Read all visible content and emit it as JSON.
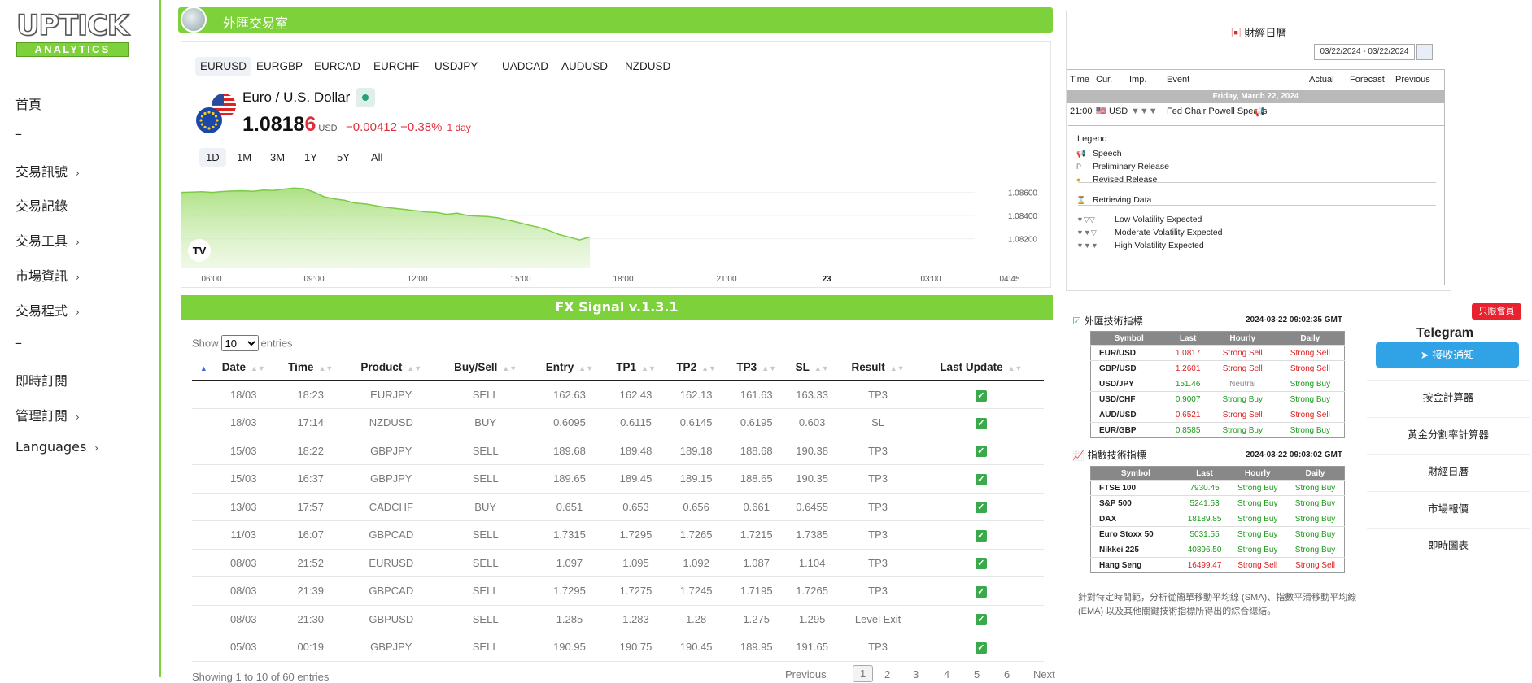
{
  "sidebar": {
    "logo_top": "UPTICK",
    "logo_bottom": "ANALYTICS",
    "items": [
      "首頁",
      "–",
      "交易訊號",
      "交易記錄",
      "交易工具",
      "市場資訊",
      "交易程式",
      "–",
      "即時訂閱",
      "管理訂閱",
      "Languages"
    ],
    "chevrons": [
      false,
      false,
      true,
      false,
      true,
      true,
      true,
      false,
      false,
      true,
      true
    ]
  },
  "header": {
    "title": "外匯交易室"
  },
  "widget": {
    "symbols": [
      "EURUSD",
      "EURGBP",
      "EURCAD",
      "EURCHF",
      "USDJPY",
      "UADCAD",
      "AUDUSD",
      "NZDUSD"
    ],
    "active_symbol": "EURUSD",
    "pair_name": "Euro / U.S. Dollar",
    "price_main": "1.0818",
    "price_last": "6",
    "currency": "USD",
    "change": "−0.00412",
    "change_pct": "−0.38%",
    "period": "1 day",
    "ranges": [
      "1D",
      "1M",
      "3M",
      "1Y",
      "5Y",
      "All"
    ],
    "active_range": "1D"
  },
  "chart_data": {
    "type": "area",
    "x_labels": [
      "06:00",
      "09:00",
      "12:00",
      "15:00",
      "18:00",
      "21:00",
      "23",
      "03:00",
      "04:45"
    ],
    "y_labels": [
      "1.08600",
      "1.08400",
      "1.08200"
    ],
    "ylim": [
      1.081,
      1.087
    ],
    "x": [
      0,
      0.3,
      0.6,
      0.9,
      1.2,
      1.5,
      1.8,
      2.1,
      2.4,
      2.7,
      3.0,
      3.3,
      3.6,
      3.9,
      4.2,
      4.5,
      4.8,
      5.1,
      5.4,
      5.7,
      6.0,
      6.3,
      6.6,
      6.9,
      7.2,
      7.5,
      7.8,
      8.1,
      8.4,
      8.7,
      9.0,
      9.3,
      9.6,
      9.9,
      10.2,
      10.5,
      10.8,
      11.1,
      11.4,
      11.7,
      12.0
    ],
    "values": [
      1.08598,
      1.086,
      1.08604,
      1.08598,
      1.08606,
      1.0861,
      1.08612,
      1.08608,
      1.08618,
      1.08614,
      1.08626,
      1.08636,
      1.0863,
      1.086,
      1.0856,
      1.08542,
      1.0853,
      1.08506,
      1.085,
      1.08484,
      1.0847,
      1.0846,
      1.0845,
      1.0844,
      1.0843,
      1.08425,
      1.0841,
      1.0842,
      1.084,
      1.08395,
      1.0839,
      1.0838,
      1.0836,
      1.0834,
      1.08318,
      1.08298,
      1.0827,
      1.08236,
      1.08214,
      1.0819,
      1.08216
    ],
    "color": "#8fd65a"
  },
  "signal": {
    "title": "FX Signal v.1.3.1",
    "show_label": "Show",
    "entries_label": "entries",
    "page_size": "10",
    "columns": [
      "",
      "Date",
      "Time",
      "Product",
      "Buy/Sell",
      "Entry",
      "TP1",
      "TP2",
      "TP3",
      "SL",
      "Result",
      "Last Update"
    ],
    "rows": [
      [
        "",
        "18/03",
        "18:23",
        "EURJPY",
        "SELL",
        "162.63",
        "162.43",
        "162.13",
        "161.63",
        "163.33",
        "TP3"
      ],
      [
        "",
        "18/03",
        "17:14",
        "NZDUSD",
        "BUY",
        "0.6095",
        "0.6115",
        "0.6145",
        "0.6195",
        "0.603",
        "SL"
      ],
      [
        "",
        "15/03",
        "18:22",
        "GBPJPY",
        "SELL",
        "189.68",
        "189.48",
        "189.18",
        "188.68",
        "190.38",
        "TP3"
      ],
      [
        "",
        "15/03",
        "16:37",
        "GBPJPY",
        "SELL",
        "189.65",
        "189.45",
        "189.15",
        "188.65",
        "190.35",
        "TP3"
      ],
      [
        "",
        "13/03",
        "17:57",
        "CADCHF",
        "BUY",
        "0.651",
        "0.653",
        "0.656",
        "0.661",
        "0.6455",
        "TP3"
      ],
      [
        "",
        "11/03",
        "16:07",
        "GBPCAD",
        "SELL",
        "1.7315",
        "1.7295",
        "1.7265",
        "1.7215",
        "1.7385",
        "TP3"
      ],
      [
        "",
        "08/03",
        "21:52",
        "EURUSD",
        "SELL",
        "1.097",
        "1.095",
        "1.092",
        "1.087",
        "1.104",
        "TP3"
      ],
      [
        "",
        "08/03",
        "21:39",
        "GBPCAD",
        "SELL",
        "1.7295",
        "1.7275",
        "1.7245",
        "1.7195",
        "1.7265",
        "TP3"
      ],
      [
        "",
        "08/03",
        "21:30",
        "GBPUSD",
        "SELL",
        "1.285",
        "1.283",
        "1.28",
        "1.275",
        "1.295",
        "Level Exit"
      ],
      [
        "",
        "05/03",
        "00:19",
        "GBPJPY",
        "SELL",
        "190.95",
        "190.75",
        "190.45",
        "189.95",
        "191.65",
        "TP3"
      ]
    ],
    "info": "Showing 1 to 10 of 60 entries",
    "pages": [
      "Previous",
      "1",
      "2",
      "3",
      "4",
      "5",
      "6",
      "Next"
    ]
  },
  "calendar": {
    "title": "財經日曆",
    "date_range": "03/22/2024 - 03/22/2024",
    "columns": [
      "Time",
      "Cur.",
      "Imp.",
      "Event",
      "Actual",
      "Forecast",
      "Previous"
    ],
    "day": "Friday, March 22, 2024",
    "event": {
      "time": "21:00",
      "currency": "USD",
      "name": "Fed Chair Powell Speaks"
    },
    "legend_title": "Legend",
    "legend": [
      "Speech",
      "Preliminary Release",
      "Revised Release",
      "Retrieving Data",
      "Low Volatility Expected",
      "Moderate Volatility Expected",
      "High Volatility Expected"
    ]
  },
  "fx_tech": {
    "title": "外匯技術指標",
    "timestamp": "2024-03-22 09:02:35 GMT",
    "cols": [
      "Symbol",
      "Last",
      "Hourly",
      "Daily"
    ],
    "rows": [
      [
        "EUR/USD",
        "1.0817",
        "Strong Sell",
        "Strong Sell"
      ],
      [
        "GBP/USD",
        "1.2601",
        "Strong Sell",
        "Strong Sell"
      ],
      [
        "USD/JPY",
        "151.46",
        "Neutral",
        "Strong Buy"
      ],
      [
        "USD/CHF",
        "0.9007",
        "Strong Buy",
        "Strong Buy"
      ],
      [
        "AUD/USD",
        "0.6521",
        "Strong Sell",
        "Strong Sell"
      ],
      [
        "EUR/GBP",
        "0.8585",
        "Strong Buy",
        "Strong Buy"
      ]
    ]
  },
  "idx_tech": {
    "title": "指數技術指標",
    "timestamp": "2024-03-22 09:03:02 GMT",
    "cols": [
      "Symbol",
      "Last",
      "Hourly",
      "Daily"
    ],
    "rows": [
      [
        "FTSE 100",
        "7930.45",
        "Strong Buy",
        "Strong Buy"
      ],
      [
        "S&P 500",
        "5241.53",
        "Strong Buy",
        "Strong Buy"
      ],
      [
        "DAX",
        "18189.85",
        "Strong Buy",
        "Strong Buy"
      ],
      [
        "Euro Stoxx 50",
        "5031.55",
        "Strong Buy",
        "Strong Buy"
      ],
      [
        "Nikkei 225",
        "40896.50",
        "Strong Buy",
        "Strong Buy"
      ],
      [
        "Hang Seng",
        "16499.47",
        "Strong Sell",
        "Strong Sell"
      ]
    ]
  },
  "tech_note": "針對特定時間範，分析從簡單移動平均線 (SMA)、指數平滑移動平均線 (EMA) 以及其他關鍵技術指標所得出的綜合總結。",
  "member": {
    "badge": "只限會員",
    "telegram": "Telegram",
    "notify": "接收通知",
    "links": [
      "按金計算器",
      "黃金分割率計算器",
      "財經日曆",
      "市場報價",
      "即時圖表"
    ]
  }
}
